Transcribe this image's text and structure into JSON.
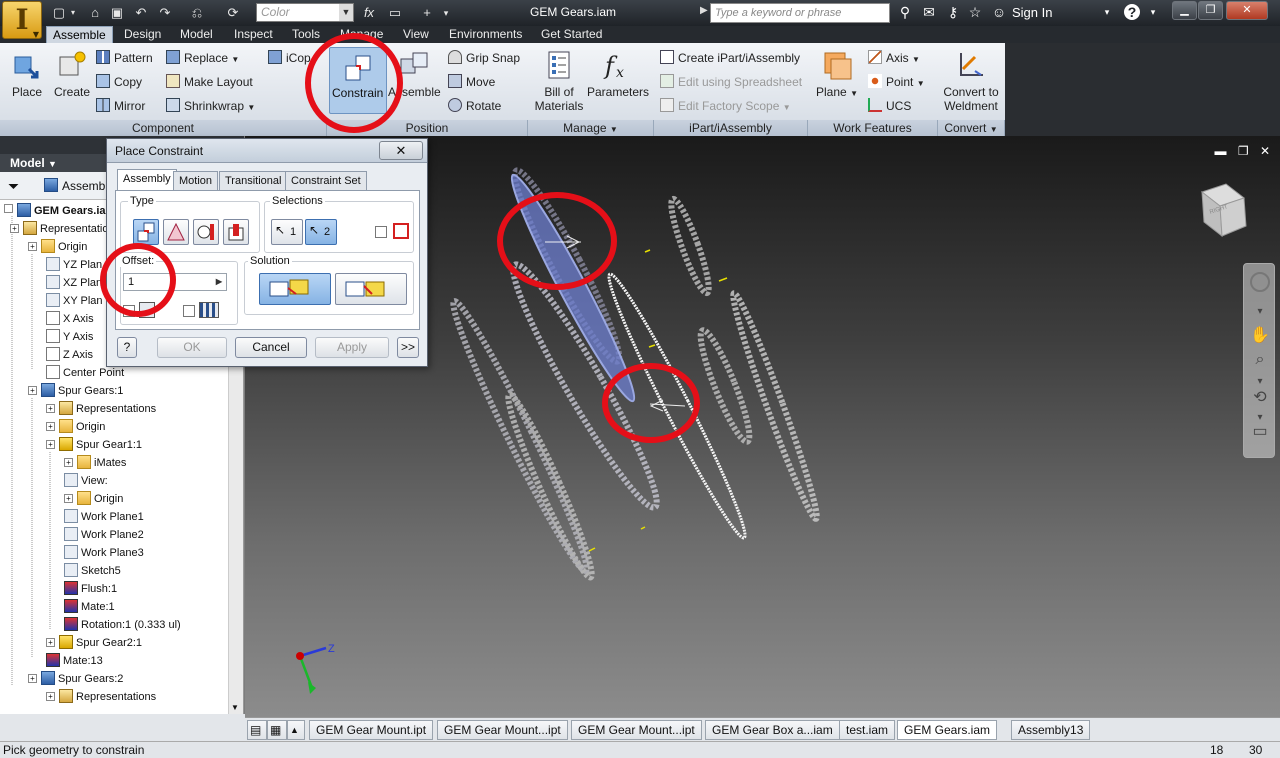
{
  "app": {
    "logo_letter": "I",
    "document_title": "GEM Gears.iam",
    "color_placeholder": "Color",
    "search_placeholder": "Type a keyword or phrase",
    "sign_in": "Sign In",
    "help": "?"
  },
  "ribbon": {
    "tabs": [
      "Assemble",
      "Design",
      "Model",
      "Inspect",
      "Tools",
      "Manage",
      "View",
      "Environments",
      "Get Started"
    ],
    "component": {
      "label": "Component",
      "place": "Place",
      "create": "Create",
      "pattern": "Pattern",
      "copy": "Copy",
      "mirror": "Mirror",
      "replace": "Replace",
      "make_layout": "Make Layout",
      "shrinkwrap": "Shrinkwrap",
      "icopy": "iCop"
    },
    "position": {
      "label": "Position",
      "constrain": "Constrain",
      "assemble": "Assemble",
      "grip_snap": "Grip Snap",
      "move": "Move",
      "rotate": "Rotate"
    },
    "manage": {
      "label": "Manage",
      "bill_of_materials_1": "Bill of",
      "bill_of_materials_2": "Materials",
      "parameters": "Parameters"
    },
    "ipart": {
      "label": "iPart/iAssembly",
      "create": "Create iPart/iAssembly",
      "edit_spreadsheet": "Edit using Spreadsheet",
      "edit_factory": "Edit Factory Scope"
    },
    "work_features": {
      "label": "Work Features",
      "plane": "Plane",
      "axis": "Axis",
      "point": "Point",
      "ucs": "UCS"
    },
    "convert": {
      "label": "Convert",
      "convert_to_1": "Convert to",
      "convert_to_2": "Weldment"
    }
  },
  "browser": {
    "header": "Model",
    "toolbar_label": "Assembl",
    "rows": [
      {
        "label": "GEM Gears.iam",
        "bold": true
      },
      {
        "label": "Representation"
      },
      {
        "label": "Origin"
      },
      {
        "label": "YZ Plan"
      },
      {
        "label": "XZ Plan"
      },
      {
        "label": "XY Plan"
      },
      {
        "label": "X Axis"
      },
      {
        "label": "Y Axis"
      },
      {
        "label": "Z Axis"
      },
      {
        "label": "Center Point"
      },
      {
        "label": "Spur Gears:1"
      },
      {
        "label": "Representations"
      },
      {
        "label": "Origin"
      },
      {
        "label": "Spur Gear1:1"
      },
      {
        "label": "iMates"
      },
      {
        "label": "View:"
      },
      {
        "label": "Origin"
      },
      {
        "label": "Work Plane1"
      },
      {
        "label": "Work Plane2"
      },
      {
        "label": "Work Plane3"
      },
      {
        "label": "Sketch5"
      },
      {
        "label": "Flush:1"
      },
      {
        "label": "Mate:1"
      },
      {
        "label": "Rotation:1 (0.333 ul)"
      },
      {
        "label": "Spur Gear2:1"
      },
      {
        "label": "Mate:13"
      },
      {
        "label": "Spur Gears:2"
      },
      {
        "label": "Representations"
      }
    ]
  },
  "dialog": {
    "title": "Place Constraint",
    "close": "✕",
    "tabs": [
      "Assembly",
      "Motion",
      "Transitional",
      "Constraint Set"
    ],
    "type_label": "Type",
    "selections_label": "Selections",
    "sel1": "1",
    "sel2": "2",
    "offset_label": "Offset:",
    "offset_value": "1",
    "solution_label": "Solution",
    "ok": "OK",
    "cancel": "Cancel",
    "apply": "Apply",
    "more": ">>",
    "help": "?"
  },
  "viewport": {
    "viewcube_face": "RIGHT",
    "triad_z": "Z"
  },
  "doc_tabs": [
    "GEM Gear Mount.ipt",
    "GEM Gear Mount...ipt",
    "GEM Gear Mount...ipt",
    "GEM Gear Box a...iam",
    "test.iam",
    "GEM Gears.iam",
    "Assembly13"
  ],
  "status": {
    "text": "Pick geometry to constrain",
    "num1": "18",
    "num2": "30"
  },
  "colors": {
    "annotation": "#e50f18",
    "selected_gear": "#6e7fd0",
    "ribbon_selected": "#aecbea"
  }
}
